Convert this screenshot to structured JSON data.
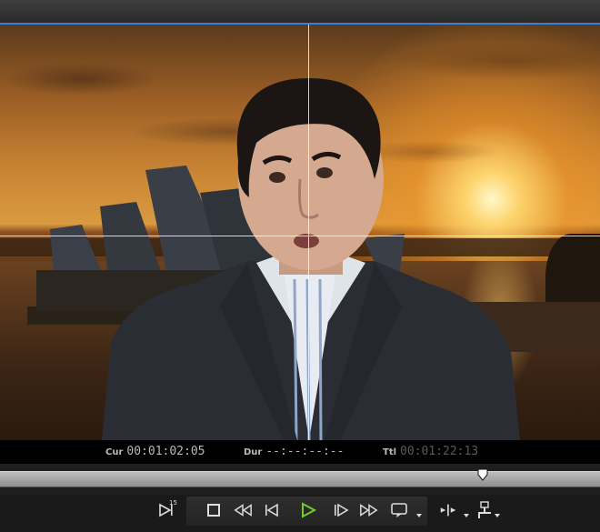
{
  "timecode": {
    "current_label": "Cur",
    "current_value": "00:01:02:05",
    "duration_label": "Dur",
    "duration_value": "--:--:--:--",
    "total_label": "Ttl",
    "total_value": "00:01:22:13"
  },
  "playback": {
    "playhead_position_fraction": 0.805,
    "jog_speed_superscript": "15"
  },
  "controls": [
    {
      "name": "jog-forward-button",
      "icon": "jog-icon"
    },
    {
      "name": "stop-button",
      "icon": "stop-icon"
    },
    {
      "name": "rewind-button",
      "icon": "rewind-icon"
    },
    {
      "name": "previous-frame-button",
      "icon": "previous-frame-icon"
    },
    {
      "name": "play-button",
      "icon": "play-icon",
      "color": "#6fcf2b"
    },
    {
      "name": "next-frame-button",
      "icon": "next-frame-icon"
    },
    {
      "name": "fast-forward-button",
      "icon": "fast-forward-icon"
    },
    {
      "name": "output-display-button",
      "icon": "monitor-icon"
    },
    {
      "name": "mark-in-out-button",
      "icon": "mark-icon"
    },
    {
      "name": "mode-button",
      "icon": "mode-icon"
    }
  ],
  "colors": {
    "accent_blue": "#3b7fd0",
    "play_green": "#6fcf2b",
    "grid_line": "#ffffff"
  }
}
